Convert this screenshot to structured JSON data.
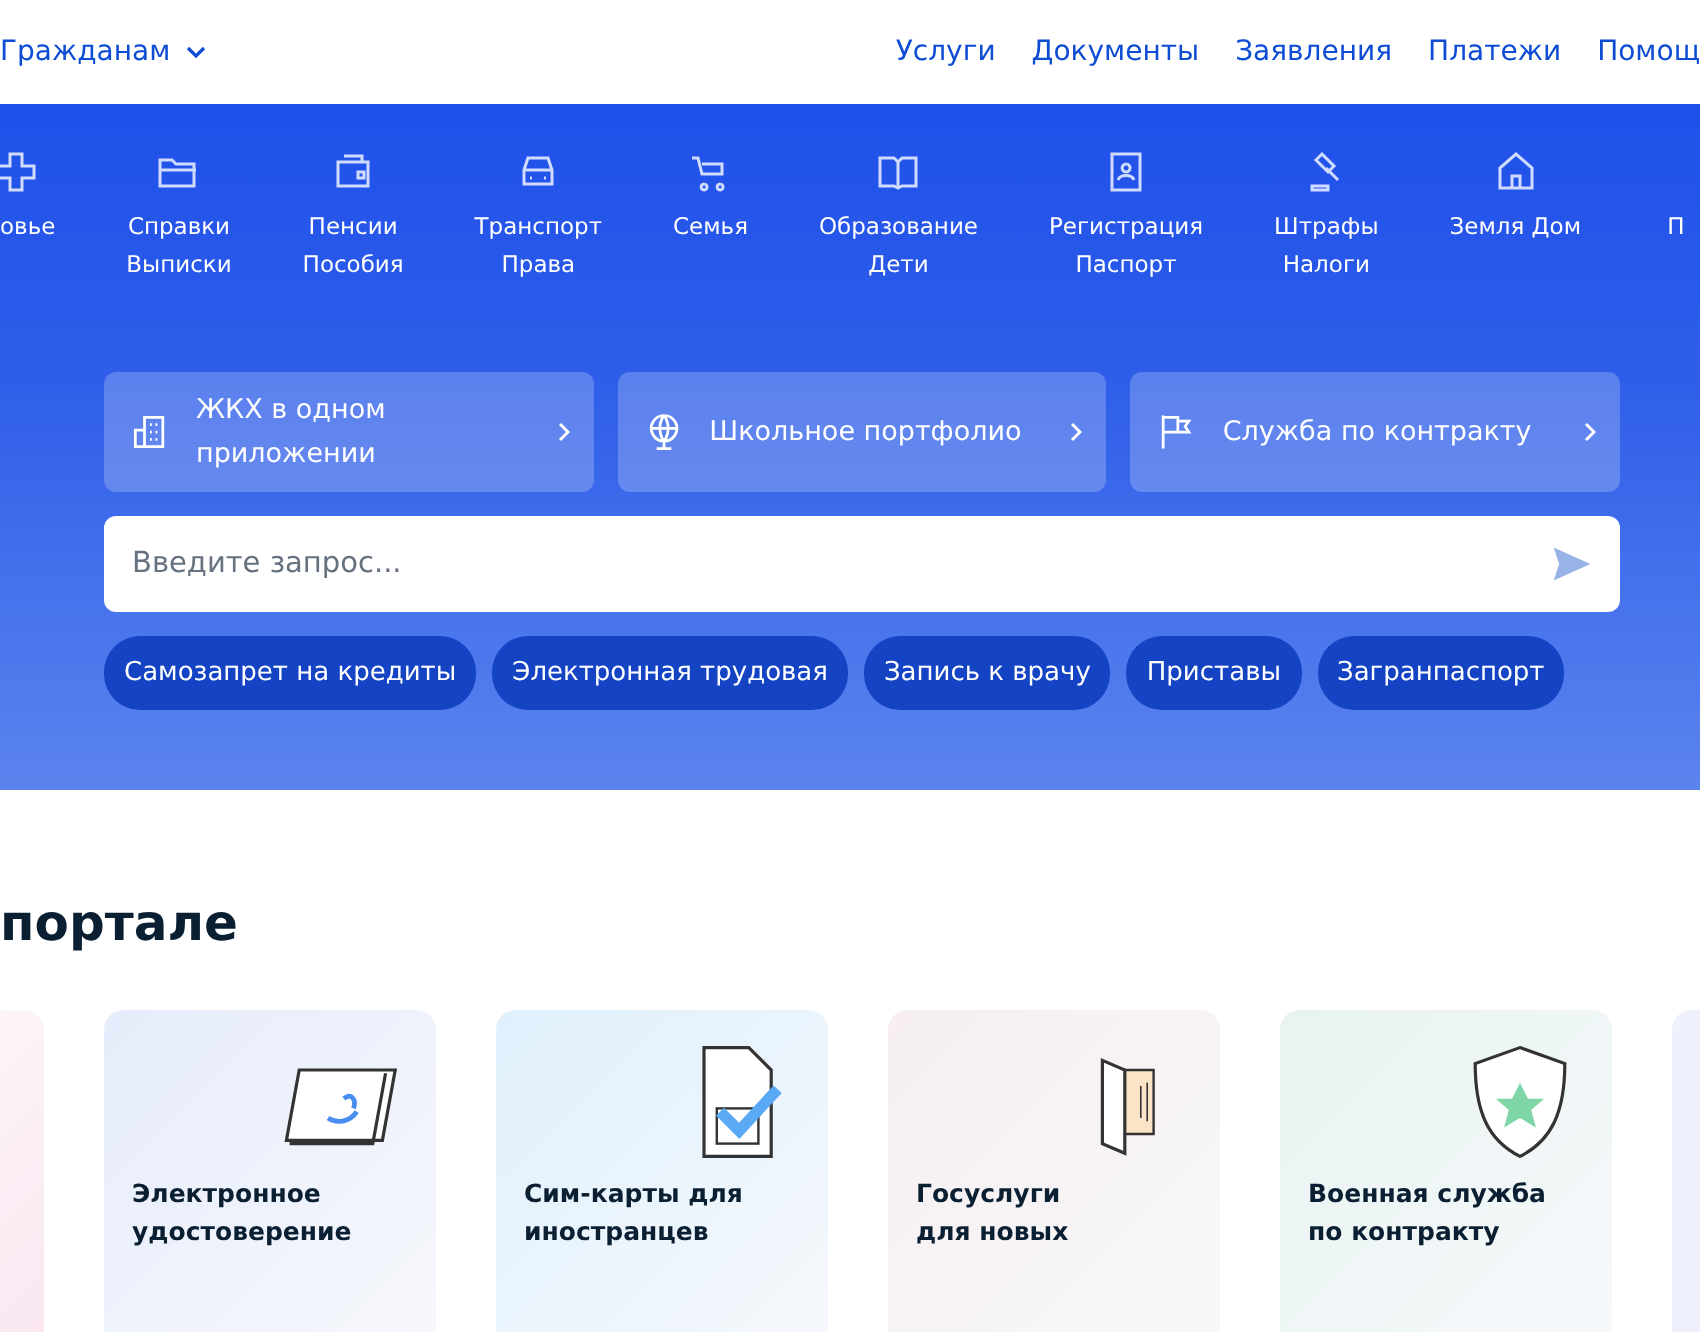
{
  "header": {
    "audience": "Гражданам",
    "nav": [
      "Услуги",
      "Документы",
      "Заявления",
      "Платежи",
      "Помощ"
    ]
  },
  "categories": [
    {
      "label": "овье"
    },
    {
      "label": "Справки\nВыписки"
    },
    {
      "label": "Пенсии\nПособия"
    },
    {
      "label": "Транспорт\nПрава"
    },
    {
      "label": "Семья"
    },
    {
      "label": "Образование\nДети"
    },
    {
      "label": "Регистрация\nПаспорт"
    },
    {
      "label": "Штрафы\nНалоги"
    },
    {
      "label": "Земля Дом"
    },
    {
      "label": "П"
    }
  ],
  "quick_links": [
    {
      "label": "ЖКХ в одном приложении"
    },
    {
      "label": "Школьное портфолио"
    },
    {
      "label": "Служба по контракту"
    }
  ],
  "search": {
    "placeholder": "Введите запрос..."
  },
  "chips": [
    "Самозапрет на кредиты",
    "Электронная трудовая",
    "Запись к врачу",
    "Приставы",
    "Загранпаспорт"
  ],
  "section_title": "портале",
  "cards": [
    {
      "title": "Электронное\nудостоверение",
      "color": "#e6ecfb"
    },
    {
      "title": "Сим-карты для\nиностранцев",
      "color": "#dff0fc"
    },
    {
      "title": "Госуслуги\nдля новых",
      "color": "#f6eeef"
    },
    {
      "title": "Военная служба\nпо контракту",
      "color": "#e8f3f1"
    }
  ]
}
